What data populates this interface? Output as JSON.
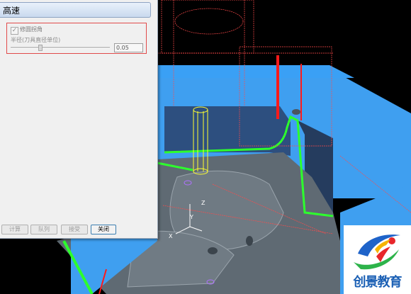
{
  "dialog": {
    "title": "高速",
    "option": {
      "checkbox_label": "修圆拐角",
      "checked": true,
      "radius_label": "半径(刀具直径单位)",
      "radius_value": "0.05",
      "slider_fraction": 0.3
    },
    "buttons": [
      {
        "label": "计算"
      },
      {
        "label": "队列"
      },
      {
        "label": "接受"
      },
      {
        "label": "关闭"
      }
    ]
  },
  "watermark": {
    "text": "创景教育"
  },
  "colors": {
    "model_blue": "#3f9ff0",
    "toolpath_red": "#ff1a1a",
    "toolpath_green": "#2dff2d",
    "tool_yellow": "#ffff30",
    "background": "#000000"
  }
}
